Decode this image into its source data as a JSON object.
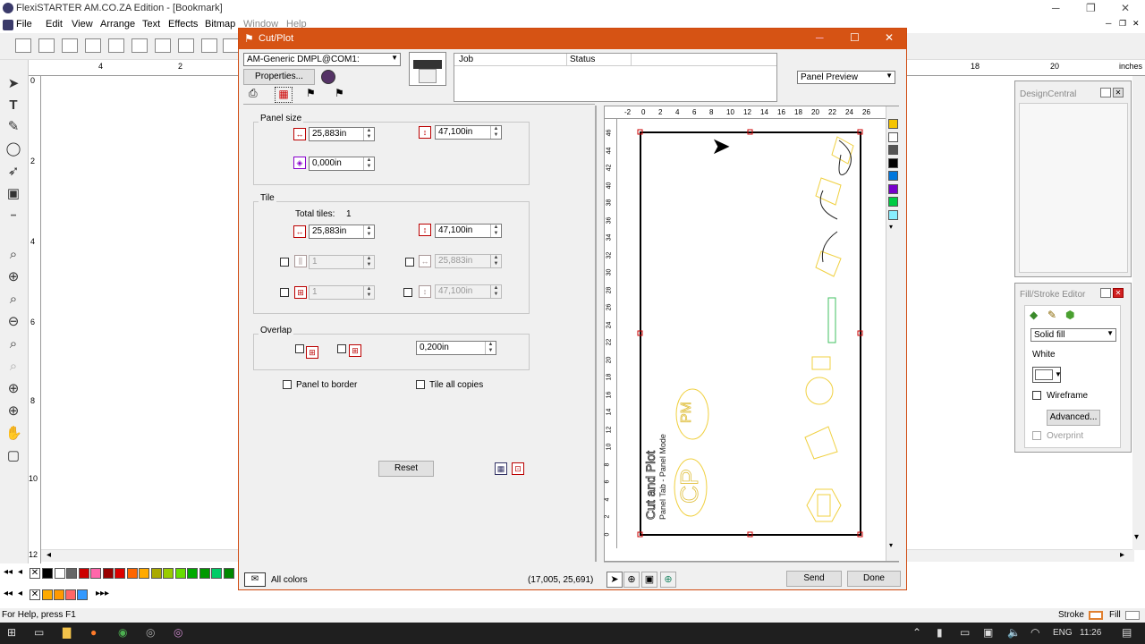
{
  "app": {
    "title": "FlexiSTARTER AM.CO.ZA Edition - [Bookmark]",
    "menu": [
      "File",
      "Edit",
      "View",
      "Arrange",
      "Text",
      "Effects",
      "Bitmap",
      "Window",
      "Help"
    ],
    "ruler_h_labels": [
      "4",
      "2",
      "18",
      "20",
      "inches"
    ],
    "ruler_v_labels": [
      "0",
      "2",
      "4",
      "6",
      "8",
      "10",
      "12"
    ],
    "status_help": "For Help, press F1",
    "stroke_label": "Stroke",
    "fill_label": "Fill",
    "palette_colors": [
      "#000000",
      "#ffffff",
      "#666666",
      "#cc0000",
      "#ff66aa",
      "#990000",
      "#dd0000",
      "#ff6600",
      "#ffaa00",
      "#aaaa00",
      "#99cc00",
      "#66dd00",
      "#00aa00",
      "#009900",
      "#00cc66",
      "#008800"
    ],
    "palette2_colors": [
      "#ffaa00",
      "#ff9900",
      "#ff6666",
      "#3399ff"
    ]
  },
  "taskbar": {
    "time": "11:26",
    "lang": "ENG"
  },
  "dialog": {
    "title": "Cut/Plot",
    "device": "AM-Generic DMPL@COM1:",
    "properties_label": "Properties...",
    "job_col": "Job",
    "status_col": "Status",
    "preview_mode": "Panel Preview",
    "panel_size": {
      "label": "Panel size",
      "width": "25,883in",
      "height": "47,100in",
      "rotation": "0,000in"
    },
    "tile": {
      "label": "Tile",
      "total_tiles_label": "Total tiles:",
      "total_tiles_value": "1",
      "width": "25,883in",
      "height": "47,100in",
      "cols": "1",
      "tile_w": "25,883in",
      "rows": "1",
      "tile_h": "47,100in"
    },
    "overlap": {
      "label": "Overlap",
      "value": "0,200in"
    },
    "panel_to_border": "Panel to border",
    "tile_all_copies": "Tile all copies",
    "reset_label": "Reset",
    "all_colors": "All colors",
    "coords": "(17,005, 25,691)",
    "send_label": "Send",
    "done_label": "Done",
    "preview_ruler_h": [
      "-2",
      "0",
      "2",
      "4",
      "6",
      "8",
      "10",
      "12",
      "14",
      "16",
      "18",
      "20",
      "22",
      "24",
      "26"
    ],
    "preview_ruler_v": [
      "46",
      "44",
      "42",
      "40",
      "38",
      "36",
      "34",
      "32",
      "30",
      "28",
      "26",
      "24",
      "22",
      "20",
      "18",
      "16",
      "14",
      "12",
      "10",
      "8",
      "6",
      "4",
      "2",
      "0"
    ],
    "preview_text_1": "Cut and Plot",
    "preview_text_2": "Panel Tab - Panel Mode",
    "preview_text_pm": "PM",
    "preview_text_cp": "CP",
    "preview_palette": [
      "#f5c400",
      "#ffffff",
      "#555555",
      "#000000",
      "#0077dd",
      "#7700cc",
      "#00cc44",
      "#88eeff"
    ]
  },
  "design_central": {
    "title": "DesignCentral"
  },
  "fill_stroke": {
    "title": "Fill/Stroke Editor",
    "fill_type": "Solid fill",
    "color_name": "White",
    "wireframe": "Wireframe",
    "advanced": "Advanced...",
    "overprint": "Overprint"
  }
}
